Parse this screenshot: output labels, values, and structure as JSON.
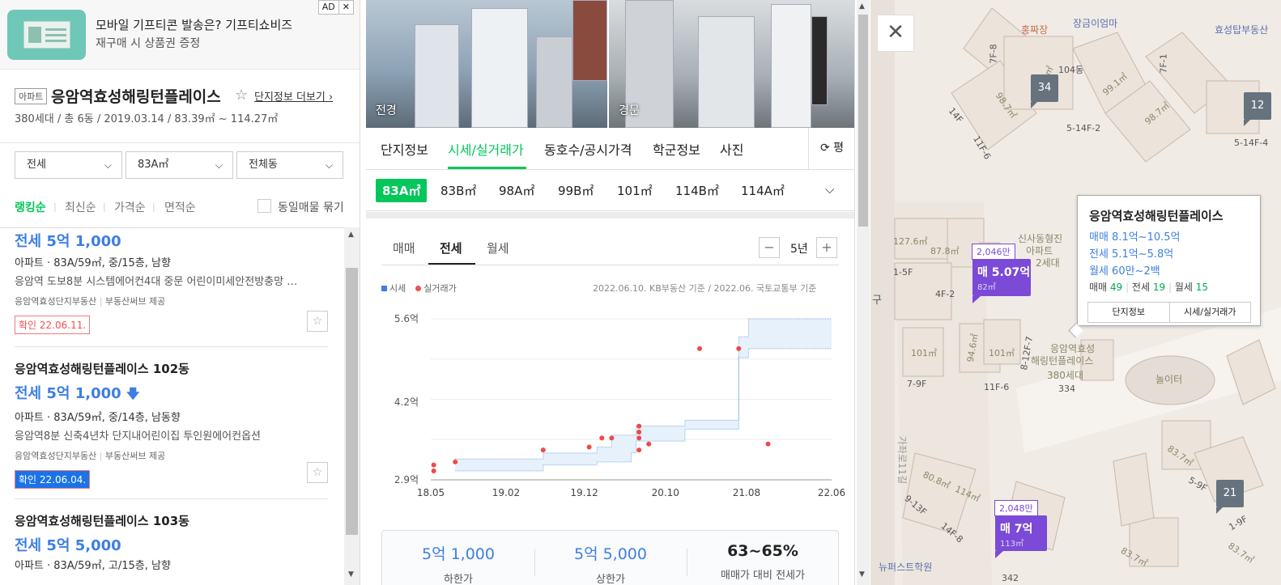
{
  "ad": {
    "badge": "AD",
    "close": "✕",
    "title": "모바일 기프티콘 발송은? 기프티쇼비즈",
    "subtitle": "재구매 시 상품권 증정"
  },
  "complex": {
    "type": "아파트",
    "name": "응암역효성해링턴플레이스",
    "more_link": "단지정보 더보기",
    "info": "380세대 / 총 6동 / 2019.03.14 / 83.39㎡ ~ 114.27㎡"
  },
  "filters": {
    "trade": "전세",
    "area": "83A㎡",
    "dong": "전체동"
  },
  "sort": {
    "options": [
      "랭킹순",
      "최신순",
      "가격순",
      "면적순"
    ],
    "active": "랭킹순",
    "same_listing": "동일매물 묶기"
  },
  "listings": [
    {
      "price": "전세 5억 1,000",
      "spec": "아파트 · 83A/59㎡, 중/15층, 남향",
      "desc": "응암역 도보8분 시스템에어컨4대 중문 어린이미세안전방충망 …",
      "agency": "응암역효성단지부동산",
      "provider": "부동산써브 제공",
      "confirmed": "확인 22.06.11."
    },
    {
      "title": "응암역효성해링턴플레이스 102동",
      "price": "전세 5억 1,000",
      "spec": "아파트 · 83A/59㎡, 중/14층, 남동향",
      "desc": "응암역8분 신축4년차 단지내어린이집 투인원에어컨옵션",
      "agency": "응암역효성단지부동산",
      "provider": "부동산써브 제공",
      "confirmed_prefix": "확인",
      "confirmed_date": "22.06.04."
    },
    {
      "title": "응암역효성해링턴플레이스 103동",
      "price": "전세 5억 5,000",
      "spec": "아파트 · 83A/59㎡, 고/15층, 남향"
    }
  ],
  "photos": {
    "p1": "전경",
    "p2": "경문"
  },
  "detail_tabs": {
    "items": [
      "단지정보",
      "시세/실거래가",
      "동호수/공시가격",
      "학군정보",
      "사진"
    ],
    "active": "시세/실거래가",
    "unit_toggle": "평"
  },
  "area_tabs": {
    "items": [
      "83A㎡",
      "83B㎡",
      "98A㎡",
      "99B㎡",
      "101㎡",
      "114B㎡",
      "114A㎡"
    ],
    "active": "83A㎡"
  },
  "trade_tabs": {
    "items": [
      "매매",
      "전세",
      "월세"
    ],
    "active": "전세"
  },
  "period": {
    "value": "5년",
    "minus": "−",
    "plus": "+"
  },
  "legend": {
    "market": "시세",
    "actual": "실거래가",
    "note": "2022.06.10. KB부동산 기준 / 2022.06. 국토교통부 기준"
  },
  "chart_data": {
    "type": "line",
    "x_ticks": [
      "18.05",
      "19.02",
      "19.12",
      "20.10",
      "21.08",
      "22.06"
    ],
    "y_ticks": [
      "5.6억",
      "4.2억",
      "2.9억"
    ],
    "ylim_eok": [
      2.9,
      5.6
    ],
    "series": [
      {
        "name": "시세",
        "band_upper": [
          [
            2018.6,
            3.25
          ],
          [
            2019.5,
            3.25
          ],
          [
            2019.5,
            3.35
          ],
          [
            2020.05,
            3.35
          ],
          [
            2020.05,
            3.45
          ],
          [
            2020.2,
            3.45
          ],
          [
            2020.2,
            3.65
          ],
          [
            2020.45,
            3.65
          ],
          [
            2020.45,
            3.8
          ],
          [
            2020.95,
            3.8
          ],
          [
            2020.95,
            3.9
          ],
          [
            2021.5,
            3.9
          ],
          [
            2021.5,
            5.3
          ],
          [
            2021.6,
            5.3
          ],
          [
            2021.6,
            5.6
          ],
          [
            2022.45,
            5.6
          ]
        ],
        "band_lower": [
          [
            2018.6,
            3.05
          ],
          [
            2019.5,
            3.05
          ],
          [
            2019.5,
            3.15
          ],
          [
            2020.05,
            3.15
          ],
          [
            2020.05,
            3.2
          ],
          [
            2020.4,
            3.2
          ],
          [
            2020.4,
            3.35
          ],
          [
            2020.45,
            3.35
          ],
          [
            2020.45,
            3.55
          ],
          [
            2020.95,
            3.55
          ],
          [
            2020.95,
            3.75
          ],
          [
            2021.5,
            3.75
          ],
          [
            2021.5,
            4.95
          ],
          [
            2021.6,
            4.95
          ],
          [
            2021.6,
            5.1
          ],
          [
            2022.45,
            5.1
          ]
        ]
      },
      {
        "name": "실거래가",
        "points": [
          [
            2018.38,
            3.05
          ],
          [
            2018.38,
            3.15
          ],
          [
            2018.6,
            3.2
          ],
          [
            2019.5,
            3.4
          ],
          [
            2019.97,
            3.45
          ],
          [
            2020.1,
            3.6
          ],
          [
            2020.2,
            3.6
          ],
          [
            2020.48,
            3.6
          ],
          [
            2020.48,
            3.7
          ],
          [
            2020.48,
            3.8
          ],
          [
            2020.48,
            3.4
          ],
          [
            2020.58,
            3.5
          ],
          [
            2021.1,
            5.1
          ],
          [
            2021.5,
            5.1
          ],
          [
            2021.8,
            3.5
          ]
        ]
      }
    ]
  },
  "stats": [
    {
      "value": "5억 1,000",
      "label": "하한가"
    },
    {
      "value": "5억 5,000",
      "label": "상한가"
    },
    {
      "value": "63~65%",
      "label": "매매가 대비 전세가"
    }
  ],
  "map": {
    "close": "✕",
    "pois": [
      "홍짜장",
      "장금이엄마",
      "효성탑부동산",
      "신사동형진",
      "아파트",
      "2세대",
      "응암역효성",
      "해링턴플레이스",
      "380세대",
      "놀이터",
      "뉴퍼스트학원"
    ],
    "labels": [
      "104동",
      "99.1㎡",
      "98.7㎡",
      "99.1㎡",
      "98.7㎡",
      "5-14F-2",
      "5-14F-4",
      "14F",
      "11F-6",
      "7F-8",
      "7F-1",
      "127.6㎡",
      "87.8㎡",
      "1-5F",
      "4F-2",
      "101㎡",
      "94.6㎡",
      "101㎡",
      "7-9F",
      "11F-6",
      "334",
      "8-12F-7",
      "83.7㎡",
      "83.7㎡",
      "5-9F",
      "80.8㎡",
      "114㎡",
      "9-13F",
      "14F-8",
      "1-9F",
      "83.7㎡",
      "342",
      "구"
    ],
    "markers": [
      {
        "top": "2,046만",
        "price": "매 5.07억",
        "area": "82㎡"
      },
      {
        "top": "2,048만",
        "price": "매 7억",
        "area": "113㎡"
      }
    ],
    "clusters": [
      "34",
      "12",
      "21"
    ],
    "popup": {
      "title": "응암역효성해링턴플레이스",
      "sale": "매매 8.1억~10.5억",
      "jeonse": "전세 5.1억~5.8억",
      "monthly": "월세 60만~2백",
      "count_sale_label": "매매",
      "count_sale": "49",
      "count_jeonse_label": "전세",
      "count_jeonse": "19",
      "count_monthly_label": "월세",
      "count_monthly": "15",
      "btn_info": "단지정보",
      "btn_price": "시세/실거래가"
    },
    "road_label": "가좌로11길"
  }
}
